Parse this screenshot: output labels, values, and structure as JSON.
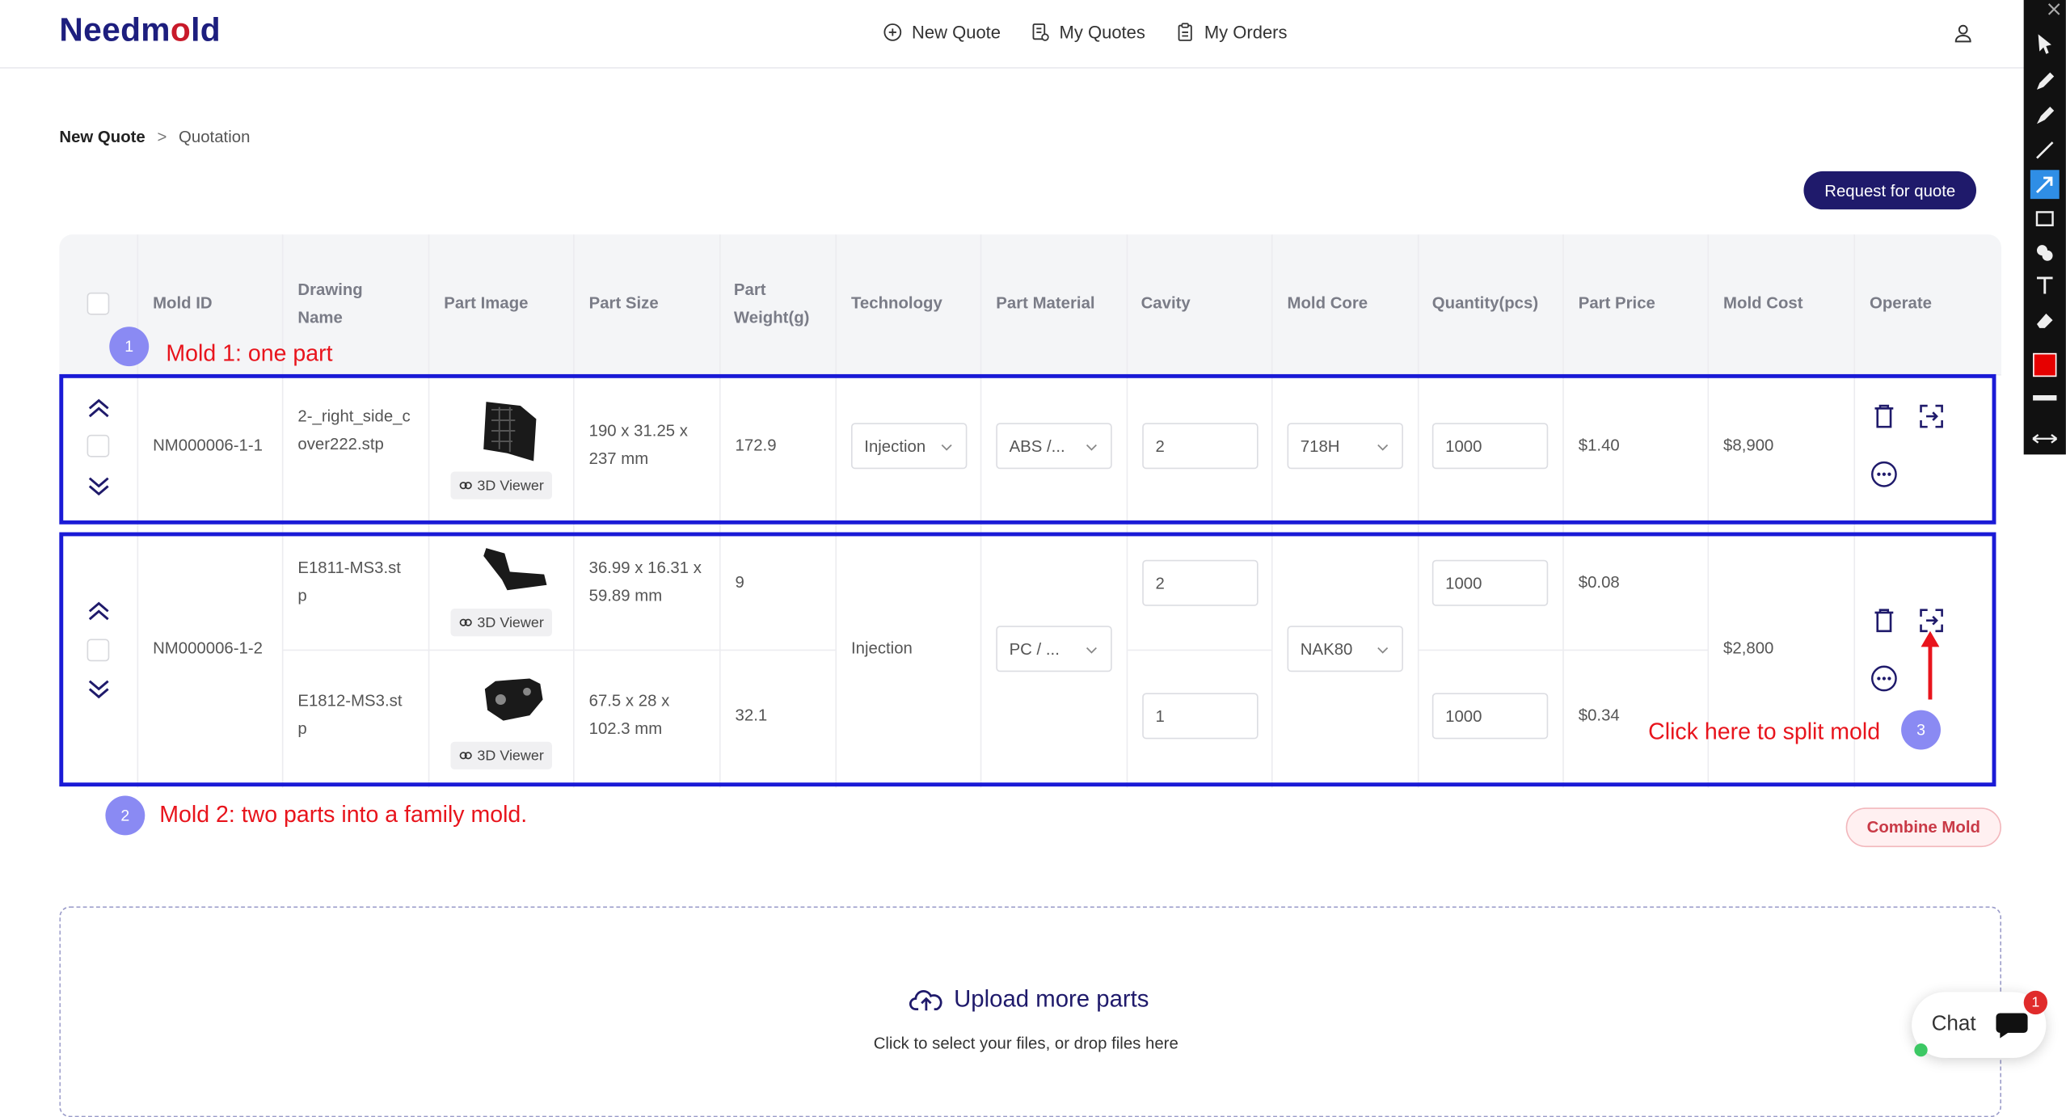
{
  "header": {
    "logo": "Needmold",
    "nav": [
      {
        "label": "New Quote",
        "icon": "plus-circle-icon"
      },
      {
        "label": "My Quotes",
        "icon": "quotes-doc-icon"
      },
      {
        "label": "My Orders",
        "icon": "clipboard-icon"
      }
    ],
    "user_icon": "user-icon"
  },
  "breadcrumb": {
    "root": "New Quote",
    "separator": ">",
    "current": "Quotation"
  },
  "actions": {
    "request_quote": "Request for quote",
    "combine_mold": "Combine Mold"
  },
  "table": {
    "columns": [
      "Mold ID",
      "Drawing Name",
      "Part Image",
      "Part Size",
      "Part Weight(g)",
      "Technology",
      "Part Material",
      "Cavity",
      "Mold Core",
      "Quantity(pcs)",
      "Part Price",
      "Mold Cost",
      "Operate"
    ],
    "molds": [
      {
        "mold_id": "NM000006-1-1",
        "technology": "Injection",
        "material": "ABS /...",
        "mold_core": "718H",
        "mold_cost": "$8,900",
        "parts": [
          {
            "drawing": "2-_right_side_cover222.stp",
            "size": "190 x 31.25 x 237 mm",
            "weight": "172.9",
            "cavity": "2",
            "quantity": "1000",
            "price": "$1.40",
            "viewer": "3D Viewer"
          }
        ]
      },
      {
        "mold_id": "NM000006-1-2",
        "technology": "Injection",
        "material": "PC / ...",
        "mold_core": "NAK80",
        "mold_cost": "$2,800",
        "parts": [
          {
            "drawing": "E1811-MS3.stp",
            "size": "36.99 x 16.31 x 59.89 mm",
            "weight": "9",
            "cavity": "2",
            "quantity": "1000",
            "price": "$0.08",
            "viewer": "3D Viewer"
          },
          {
            "drawing": "E1812-MS3.stp",
            "size": "67.5 x 28 x 102.3 mm",
            "weight": "32.1",
            "cavity": "1",
            "quantity": "1000",
            "price": "$0.34",
            "viewer": "3D Viewer"
          }
        ]
      }
    ]
  },
  "annotations": {
    "a1": {
      "num": "1",
      "text": "Mold 1: one part"
    },
    "a2": {
      "num": "2",
      "text": "Mold 2: two parts into a family mold."
    },
    "a3": {
      "num": "3",
      "text": "Click here to split mold"
    },
    "colors": {
      "box": "#1a1ad6",
      "text": "#e8141c",
      "badge": "#8a8af3"
    }
  },
  "upload": {
    "title": "Upload more parts",
    "subtitle": "Click to select your files, or drop files here"
  },
  "chat": {
    "label": "Chat",
    "unread": "1"
  },
  "colors": {
    "brand": "#1f1a6b",
    "logo_accent": "#c81a2a",
    "combine_text": "#c93a47"
  }
}
